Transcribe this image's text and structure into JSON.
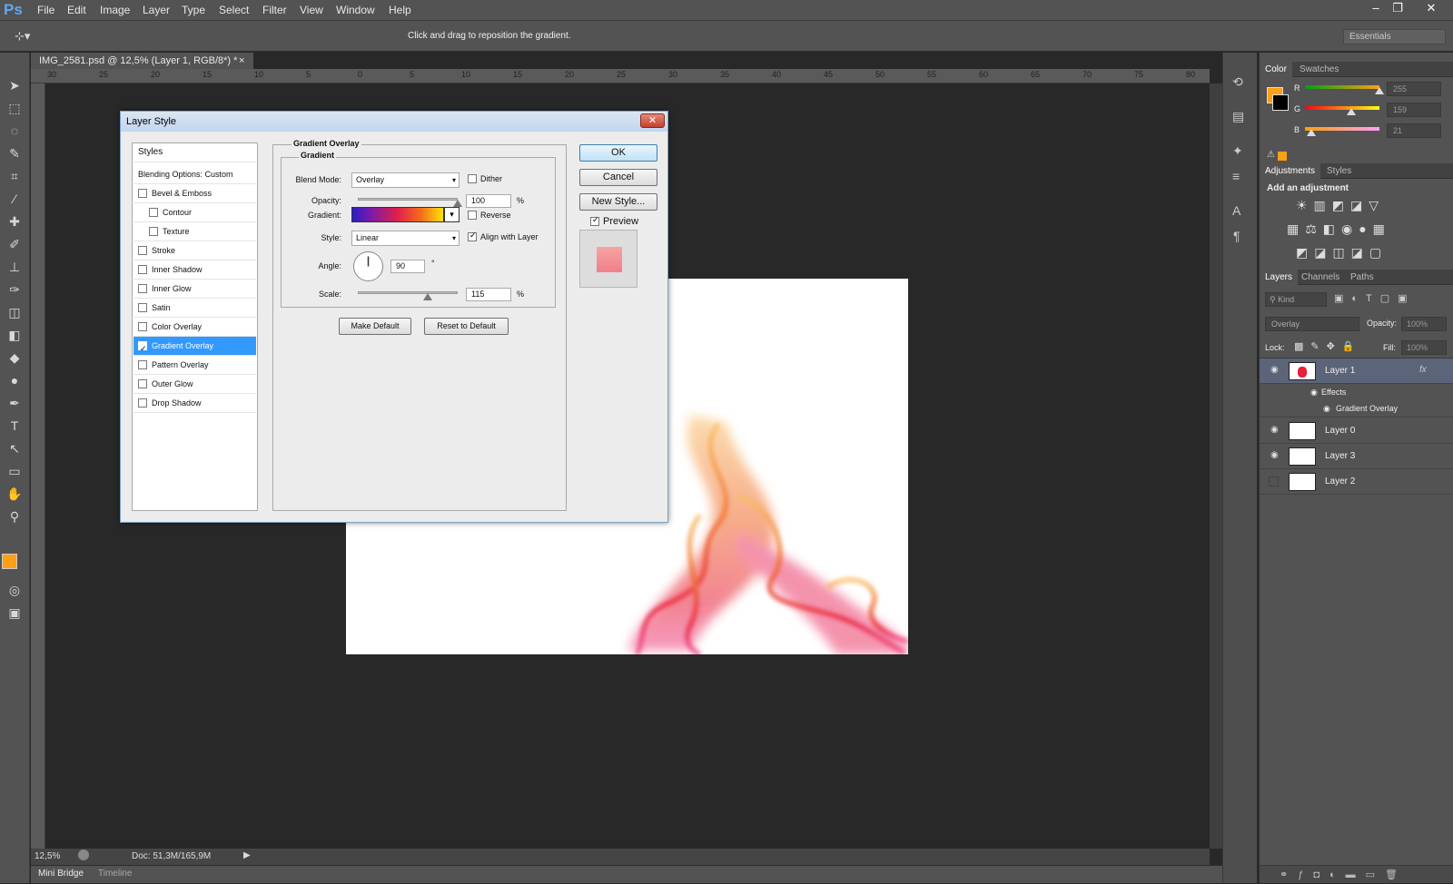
{
  "app": {
    "logo": "Ps"
  },
  "menu": [
    "File",
    "Edit",
    "Image",
    "Layer",
    "Type",
    "Select",
    "Filter",
    "View",
    "Window",
    "Help"
  ],
  "window_controls": {
    "minimize": "–",
    "restore": "❐",
    "close": "✕"
  },
  "options_bar": {
    "hint": "Click and drag to reposition the gradient.",
    "workspace": "Essentials"
  },
  "document": {
    "tab_title": "IMG_2581.psd @ 12,5% (Layer 1, RGB/8*) *",
    "tab_close": "×",
    "zoom": "12,5%",
    "doc_size": "Doc: 51,3M/165,9M",
    "ruler_ticks": [
      "30",
      "25",
      "20",
      "15",
      "10",
      "5",
      "0",
      "5",
      "10",
      "15",
      "20",
      "25",
      "30",
      "35",
      "40",
      "45",
      "50",
      "55",
      "60",
      "65",
      "70",
      "75",
      "80"
    ]
  },
  "bottom_tabs": [
    "Mini Bridge",
    "Timeline"
  ],
  "dialog": {
    "title": "Layer Style",
    "close": "✕",
    "styles_header": "Styles",
    "blending": "Blending Options: Custom",
    "style_items": [
      {
        "label": "Bevel & Emboss",
        "checked": false,
        "sub": false
      },
      {
        "label": "Contour",
        "checked": false,
        "sub": true
      },
      {
        "label": "Texture",
        "checked": false,
        "sub": true
      },
      {
        "label": "Stroke",
        "checked": false,
        "sub": false
      },
      {
        "label": "Inner Shadow",
        "checked": false,
        "sub": false
      },
      {
        "label": "Inner Glow",
        "checked": false,
        "sub": false
      },
      {
        "label": "Satin",
        "checked": false,
        "sub": false
      },
      {
        "label": "Color Overlay",
        "checked": false,
        "sub": false
      },
      {
        "label": "Gradient Overlay",
        "checked": true,
        "sub": false
      },
      {
        "label": "Pattern Overlay",
        "checked": false,
        "sub": false
      },
      {
        "label": "Outer Glow",
        "checked": false,
        "sub": false
      },
      {
        "label": "Drop Shadow",
        "checked": false,
        "sub": false
      }
    ],
    "group_title": "Gradient Overlay",
    "subgroup_title": "Gradient",
    "blend_mode_label": "Blend Mode:",
    "blend_mode": "Overlay",
    "dither_label": "Dither",
    "dither": false,
    "opacity_label": "Opacity:",
    "opacity": "100",
    "opacity_fraction": 1.0,
    "percent": "%",
    "gradient_label": "Gradient:",
    "reverse_label": "Reverse",
    "reverse": false,
    "style_label": "Style:",
    "style": "Linear",
    "align_label": "Align with Layer",
    "align": true,
    "angle_label": "Angle:",
    "angle": "90",
    "degree": "°",
    "scale_label": "Scale:",
    "scale": "115",
    "scale_fraction": 0.7,
    "make_default": "Make Default",
    "reset_default": "Reset to Default",
    "ok": "OK",
    "cancel": "Cancel",
    "new_style": "New Style...",
    "preview_label": "Preview",
    "preview": true
  },
  "color_panel": {
    "tabs": [
      "Color",
      "Swatches"
    ],
    "channels": [
      {
        "name": "R",
        "value": "255",
        "fraction": 1.0
      },
      {
        "name": "G",
        "value": "159",
        "fraction": 0.62
      },
      {
        "name": "B",
        "value": "21",
        "fraction": 0.08
      }
    ],
    "foreground": "#ff9f15",
    "background": "#000000"
  },
  "adjustments_panel": {
    "tabs": [
      "Adjustments",
      "Styles"
    ],
    "heading": "Add an adjustment"
  },
  "layers_panel": {
    "tabs": [
      "Layers",
      "Channels",
      "Paths"
    ],
    "kind": "Kind",
    "blend": "Overlay",
    "opacity_label": "Opacity:",
    "opacity": "100%",
    "lock_label": "Lock:",
    "fill_label": "Fill:",
    "fill": "100%",
    "layers": [
      {
        "name": "Layer 1",
        "fx": "fx",
        "selected": true,
        "visible": true
      },
      {
        "name": "Layer 0",
        "selected": false,
        "visible": true
      },
      {
        "name": "Layer 3",
        "selected": false,
        "visible": true
      },
      {
        "name": "Layer 2",
        "selected": false,
        "visible": false
      }
    ],
    "effects_label": "Effects",
    "effect_item": "Gradient Overlay"
  },
  "icons": {
    "eye": "👁",
    "check": "✓",
    "dropdown": "▾",
    "play": "▶"
  }
}
